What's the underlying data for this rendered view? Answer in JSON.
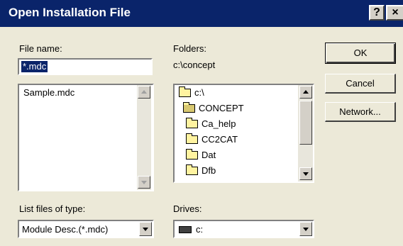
{
  "window": {
    "title": "Open Installation File",
    "help_glyph": "?",
    "close_glyph": "×"
  },
  "file_name": {
    "label": "File name:",
    "value": "*.mdc"
  },
  "file_list": {
    "items": [
      "Sample.mdc"
    ]
  },
  "folders": {
    "label": "Folders:",
    "current_path": "c:\\concept",
    "tree": [
      {
        "label": "c:\\",
        "icon": "open-folder-icon"
      },
      {
        "label": "CONCEPT",
        "icon": "open-folder-icon"
      },
      {
        "label": "Ca_help",
        "icon": "folder-icon"
      },
      {
        "label": "CC2CAT",
        "icon": "folder-icon"
      },
      {
        "label": "Dat",
        "icon": "folder-icon"
      },
      {
        "label": "Dfb",
        "icon": "folder-icon"
      }
    ]
  },
  "buttons": {
    "ok": "OK",
    "cancel": "Cancel",
    "network": "Network..."
  },
  "file_type": {
    "label": "List files of type:",
    "selected": "Module Desc.(*.mdc)"
  },
  "drives": {
    "label": "Drives:",
    "selected": "c:",
    "icon": "drive-icon"
  },
  "colors": {
    "titlebar": "#0a246a",
    "selection": "#0a246a",
    "dialog_bg": "#ece9d8"
  }
}
